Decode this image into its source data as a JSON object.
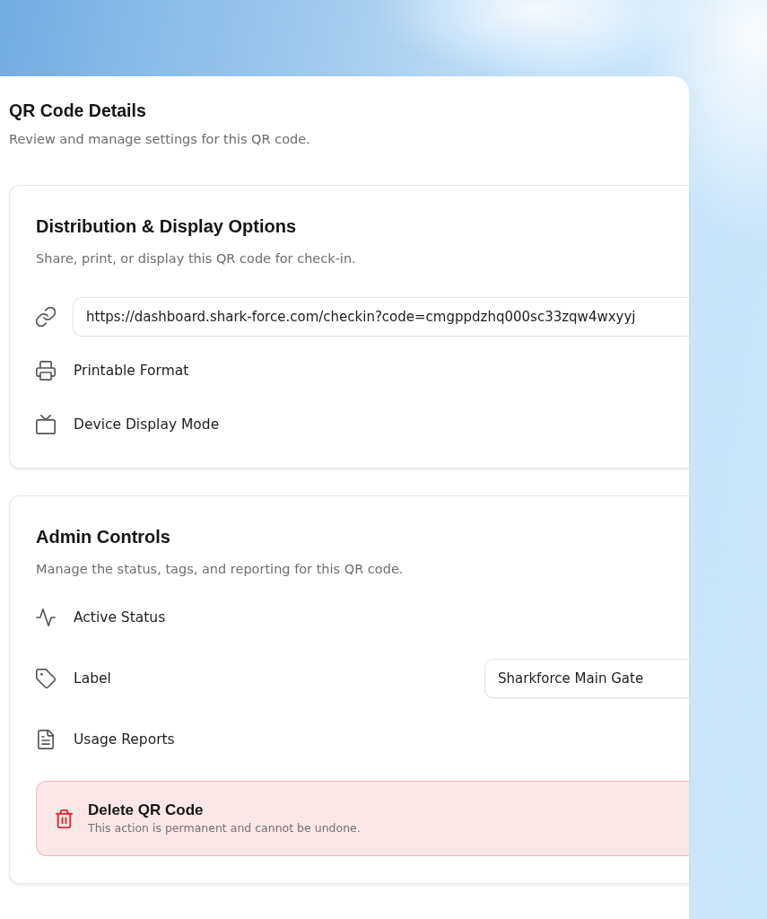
{
  "page": {
    "title": "QR Code Details",
    "subtitle": "Review and manage settings for this QR code."
  },
  "sections": [
    {
      "title": "Distribution & Display Options",
      "subtitle": "Share, print, or display this QR code for check-in.",
      "rows": [
        {
          "kind": "link",
          "value": "https://dashboard.shark-force.com/checkin?code=cmgppdzhq000sc33zqw4wxyyj"
        },
        {
          "kind": "option",
          "label": "Printable Format"
        },
        {
          "kind": "option",
          "label": "Device Display Mode"
        }
      ]
    },
    {
      "title": "Admin Controls",
      "subtitle": "Manage the status, tags, and reporting for this QR code.",
      "rows": [
        {
          "kind": "option",
          "label": "Active Status"
        },
        {
          "kind": "field",
          "label": "Label",
          "value": "Sharkforce Main Gate"
        },
        {
          "kind": "option",
          "label": "Usage Reports"
        },
        {
          "kind": "danger",
          "title": "Delete QR Code",
          "description": "This action is permanent and cannot be undone."
        }
      ]
    }
  ]
}
